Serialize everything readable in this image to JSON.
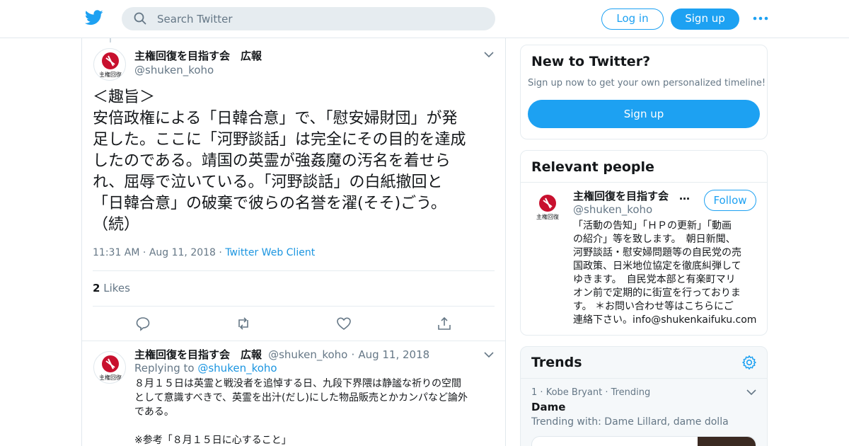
{
  "nav": {
    "search_placeholder": "Search Twitter",
    "login_label": "Log in",
    "signup_label": "Sign up",
    "brand_color": "#1da1f2"
  },
  "main_tweet": {
    "author_name": "主権回復を目指す会　広報",
    "author_handle": "@shuken_koho",
    "avatar_text": "主権回復",
    "text_lines": [
      "＜趣旨＞",
      "安倍政権による「日韓合意」で、「慰安婦財団」が発",
      "足した。ここに「河野談話」は完全にその目的を達成",
      "したのである。靖国の英霊が強姦魔の汚名を着せら",
      "れ、屈辱で泣いている。「河野談話」の白紙撤回と",
      "「日韓合意」の破棄で彼らの名誉を濯(そそ)ごう。",
      "（続）"
    ],
    "time": "11:31 AM",
    "date": "Aug 11, 2018",
    "source": "Twitter Web Client",
    "likes_count": "2",
    "likes_label": "Likes"
  },
  "reply_tweet": {
    "author_name": "主権回復を目指す会　広報",
    "author_handle": "@shuken_koho",
    "date": "Aug 11, 2018",
    "replying_to_label": "Replying to",
    "replying_to_handle": "@shuken_koho",
    "text_lines": [
      "８月１５日は英霊と戦没者を追悼する日、九段下界隈は静謐な祈りの空間",
      "として意識すべきで、英霊を出汁(だし)にした物品販売とかカンパなど論外",
      "である。",
      "",
      "※参考「８月１５日に心すること」"
    ]
  },
  "sidebar": {
    "new_to_twitter": {
      "title": "New to Twitter?",
      "subtitle": "Sign up now to get your own personalized timeline!",
      "button_label": "Sign up"
    },
    "relevant_people": {
      "title": "Relevant people",
      "name": "主権回復を目指す会　…",
      "handle": "@shuken_koho",
      "follow_label": "Follow",
      "bio_lines": [
        "「活動の告知」「ＨＰの更新」「動画",
        "の紹介」等を致します。　朝日新聞、",
        "河野談話・慰安婦問題等の自民党の売",
        "国政策、日米地位協定を徹底糾弾して",
        "ゆきます。　自民党本部と有楽町マリ",
        "オン前で定期的に街宣を行っておりま",
        "す。 ＊お問い合わせ等はこちらにご",
        "連絡下さい。info@shukenkaifuku.com"
      ]
    },
    "trends": {
      "title": "Trends",
      "items": [
        {
          "rank": "1",
          "context": "Kobe Bryant",
          "label": "Trending",
          "name": "Dame",
          "with": "Trending with: Dame Lillard, dame dolla"
        }
      ]
    }
  }
}
